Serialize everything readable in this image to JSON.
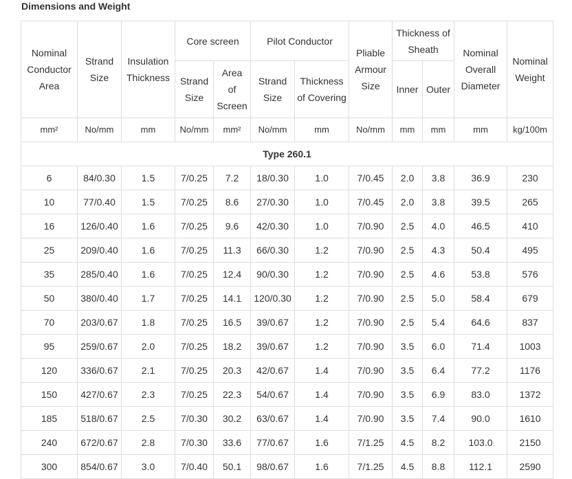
{
  "title": "Dimensions and Weight",
  "headers": {
    "nominal_area": [
      "Nominal",
      "Conductor",
      "Area"
    ],
    "strand_size": [
      "Strand",
      "Size"
    ],
    "insulation": [
      "Insulation",
      "Thickness"
    ],
    "core_screen": "Core screen",
    "core_strand": [
      "Strand",
      "Size"
    ],
    "core_area": [
      "Area",
      "of",
      "Screen"
    ],
    "pilot": "Pilot Conductor",
    "pilot_strand": [
      "Strand",
      "Size"
    ],
    "pilot_thickness": [
      "Thickness",
      "of Covering"
    ],
    "armour": [
      "Pliable",
      "Armour",
      "Size"
    ],
    "sheath": [
      "Thickness of",
      "Sheath"
    ],
    "inner": "Inner",
    "outer": "Outer",
    "diameter": [
      "Nominal",
      "Overall",
      "Diameter"
    ],
    "weight": [
      "Nominal",
      "Weight"
    ]
  },
  "units": [
    "mm²",
    "No/mm",
    "mm",
    "No/mm",
    "mm²",
    "No/mm",
    "mm",
    "No/mm",
    "mm",
    "mm",
    "mm",
    "kg/100m"
  ],
  "type_label": "Type 260.1",
  "rows": [
    [
      "6",
      "84/0.30",
      "1.5",
      "7/0.25",
      "7.2",
      "18/0.30",
      "1.0",
      "7/0.45",
      "2.0",
      "3.8",
      "36.9",
      "230"
    ],
    [
      "10",
      "77/0.40",
      "1.5",
      "7/0.25",
      "8.6",
      "27/0.30",
      "1.0",
      "7/0.45",
      "2.0",
      "3.8",
      "39.5",
      "265"
    ],
    [
      "16",
      "126/0.40",
      "1.6",
      "7/0.25",
      "9.6",
      "42/0.30",
      "1.0",
      "7/0.90",
      "2.5",
      "4.0",
      "46.5",
      "410"
    ],
    [
      "25",
      "209/0.40",
      "1.6",
      "7/0.25",
      "11.3",
      "66/0.30",
      "1.2",
      "7/0.90",
      "2.5",
      "4.3",
      "50.4",
      "495"
    ],
    [
      "35",
      "285/0.40",
      "1.6",
      "7/0.25",
      "12.4",
      "90/0.30",
      "1.2",
      "7/0.90",
      "2.5",
      "4.6",
      "53.8",
      "576"
    ],
    [
      "50",
      "380/0.40",
      "1.7",
      "7/0.25",
      "14.1",
      "120/0.30",
      "1.2",
      "7/0.90",
      "2.5",
      "5.0",
      "58.4",
      "679"
    ],
    [
      "70",
      "203/0.67",
      "1.8",
      "7/0.25",
      "16.5",
      "39/0.67",
      "1.2",
      "7/0.90",
      "2.5",
      "5.4",
      "64.6",
      "837"
    ],
    [
      "95",
      "259/0.67",
      "2.0",
      "7/0.25",
      "18.2",
      "39/0.67",
      "1.2",
      "7/0.90",
      "3.5",
      "6.0",
      "71.4",
      "1003"
    ],
    [
      "120",
      "336/0.67",
      "2.1",
      "7/0.25",
      "20.3",
      "42/0.67",
      "1.4",
      "7/0.90",
      "3.5",
      "6.4",
      "77.2",
      "1176"
    ],
    [
      "150",
      "427/0.67",
      "2.3",
      "7/0.25",
      "22.3",
      "54/0.67",
      "1.4",
      "7/0.90",
      "3.5",
      "6.9",
      "83.0",
      "1372"
    ],
    [
      "185",
      "518/0.67",
      "2.5",
      "7/0.30",
      "30.2",
      "63/0.67",
      "1.4",
      "7/0.90",
      "3.5",
      "7.4",
      "90.0",
      "1610"
    ],
    [
      "240",
      "672/0.67",
      "2.8",
      "7/0.30",
      "33.6",
      "77/0.67",
      "1.6",
      "7/1.25",
      "4.5",
      "8.2",
      "103.0",
      "2150"
    ],
    [
      "300",
      "854/0.67",
      "3.0",
      "7/0.40",
      "50.1",
      "98/0.67",
      "1.6",
      "7/1.25",
      "4.5",
      "8.8",
      "112.1",
      "2590"
    ]
  ]
}
